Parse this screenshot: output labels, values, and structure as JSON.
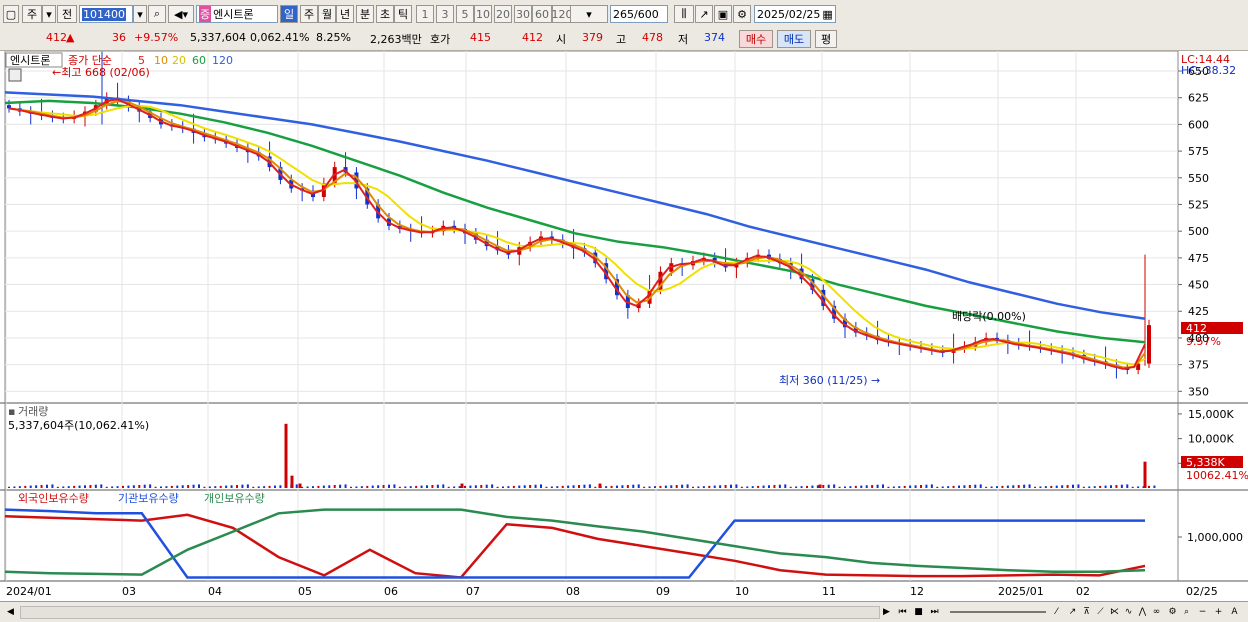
{
  "toolbar": {
    "market_type": "주",
    "prev_label": "전",
    "code": "101400",
    "name_prefix": "증",
    "name": "엔시트론",
    "periods": [
      "일",
      "주",
      "월",
      "년",
      "분",
      "초",
      "틱"
    ],
    "active_period": "일",
    "minutes": [
      "1",
      "3",
      "5",
      "10",
      "20",
      "30",
      "60",
      "120"
    ],
    "count": "265",
    "count_total": "/600",
    "date": "2025/02/25"
  },
  "quote": {
    "price": "412",
    "arrow": "▲",
    "change": "36",
    "change_pct": "+9.57%",
    "volume": "5,337,604",
    "volume_pct": "0,062.41%",
    "turnover": "8.25%",
    "amount": "2,263백만",
    "hoga_label": "호가",
    "ask": "415",
    "bid": "412",
    "open_label": "시",
    "open": "379",
    "high_label": "고",
    "high": "478",
    "low_label": "저",
    "low": "374",
    "buy_label": "매수",
    "sell_label": "매도",
    "eval_label": "평"
  },
  "price_panel": {
    "name": "엔시트론",
    "ma_title": "종가 단순",
    "ma_periods": [
      "5",
      "10",
      "20",
      "60",
      "120"
    ],
    "ma_colors": [
      "#e02020",
      "#e08a00",
      "#f0e000",
      "#18a040",
      "#3060e0"
    ],
    "lc": "LC:14.44",
    "hc": "HC:-38.32",
    "y_ticks": [
      "650",
      "625",
      "600",
      "575",
      "550",
      "525",
      "500",
      "475",
      "450",
      "425",
      "400",
      "375",
      "350"
    ],
    "price_label": "412",
    "change_label": "9.57%",
    "high_note": "최고 668 (02/06)",
    "low_note": "최저 360 (11/25)",
    "dividend_note": "배당락(0.00%)"
  },
  "volume_panel": {
    "title": "거래량",
    "summary": "5,337,604주(10,062.41%)",
    "y_ticks": [
      "15,000K",
      "10,000K",
      "5,000K"
    ],
    "last_label": "5,338K",
    "pct_label": "10062.41%"
  },
  "holding_panel": {
    "titles": [
      "외국인보유수량",
      "기관보유수량",
      "개인보유수량"
    ],
    "colors": [
      "#d01010",
      "#2050e0",
      "#2a8a50"
    ],
    "y_tick": "1,000,000"
  },
  "x_axis": {
    "labels": [
      "2024/01",
      "03",
      "04",
      "05",
      "06",
      "07",
      "08",
      "09",
      "10",
      "11",
      "12",
      "2025/01",
      "02"
    ],
    "end_label": "02/25"
  },
  "chart_data": {
    "type": "candlestick",
    "x_range": [
      "2024/01",
      "2025/02/25"
    ],
    "ylim": [
      340,
      665
    ],
    "annotations": {
      "high": 668,
      "high_date": "02/06",
      "low": 360,
      "low_date": "11/25"
    },
    "close_series": {
      "name": "엔시트론",
      "values": [
        615,
        612,
        610,
        608,
        606,
        605,
        608,
        612,
        618,
        625,
        622,
        616,
        612,
        606,
        600,
        598,
        596,
        592,
        588,
        586,
        582,
        578,
        574,
        570,
        560,
        548,
        540,
        538,
        532,
        545,
        560,
        555,
        540,
        525,
        512,
        505,
        502,
        500,
        498,
        500,
        505,
        502,
        498,
        492,
        486,
        482,
        478,
        485,
        490,
        495,
        492,
        488,
        484,
        480,
        470,
        455,
        440,
        428,
        432,
        445,
        462,
        470,
        468,
        472,
        475,
        470,
        466,
        470,
        475,
        478,
        474,
        470,
        465,
        455,
        445,
        430,
        418,
        410,
        405,
        402,
        398,
        396,
        394,
        392,
        390,
        388,
        386,
        390,
        392,
        396,
        400,
        398,
        395,
        393,
        392,
        390,
        388,
        386,
        384,
        380,
        378,
        375,
        372,
        370,
        376,
        412
      ]
    },
    "ma120_values": [
      630,
      628,
      626,
      622,
      618,
      612,
      606,
      600,
      592,
      584,
      575,
      566,
      556,
      546,
      536,
      526,
      516,
      504,
      494,
      484,
      474,
      464,
      452,
      442,
      432,
      424,
      418
    ],
    "ma60_values": [
      620,
      622,
      620,
      616,
      610,
      602,
      592,
      580,
      566,
      552,
      536,
      522,
      510,
      498,
      490,
      485,
      478,
      470,
      462,
      450,
      440,
      430,
      422,
      414,
      406,
      400,
      396
    ],
    "volume_k": {
      "values": [
        300,
        500,
        900,
        13000,
        2500,
        700,
        400,
        900,
        350,
        600,
        500,
        300,
        5338
      ]
    },
    "holding_series": [
      {
        "name": "외국인보유수량",
        "values": [
          0.86,
          0.84,
          0.82,
          0.8,
          0.88,
          0.7,
          0.3,
          0.05,
          0.4,
          0.08,
          0.02,
          0.75,
          0.7,
          0.55,
          0.45,
          0.35,
          0.25,
          0.12,
          0.06,
          0.05,
          0.04,
          0.04,
          0.05,
          0.06,
          0.05,
          0.18
        ]
      },
      {
        "name": "기관보유수량",
        "values": [
          0.95,
          0.93,
          0.9,
          0.9,
          0.02,
          0.02,
          0.02,
          0.02,
          0.02,
          0.02,
          0.02,
          0.02,
          0.02,
          0.02,
          0.02,
          0.02,
          0.8,
          0.8,
          0.8,
          0.8,
          0.8,
          0.8,
          0.8,
          0.8,
          0.8,
          0.8
        ]
      },
      {
        "name": "개인보유수량",
        "values": [
          0.1,
          0.08,
          0.07,
          0.06,
          0.4,
          0.65,
          0.9,
          0.95,
          0.95,
          0.95,
          0.95,
          0.85,
          0.8,
          0.72,
          0.65,
          0.55,
          0.45,
          0.35,
          0.3,
          0.22,
          0.18,
          0.15,
          0.12,
          0.1,
          0.1,
          0.12
        ]
      }
    ]
  }
}
